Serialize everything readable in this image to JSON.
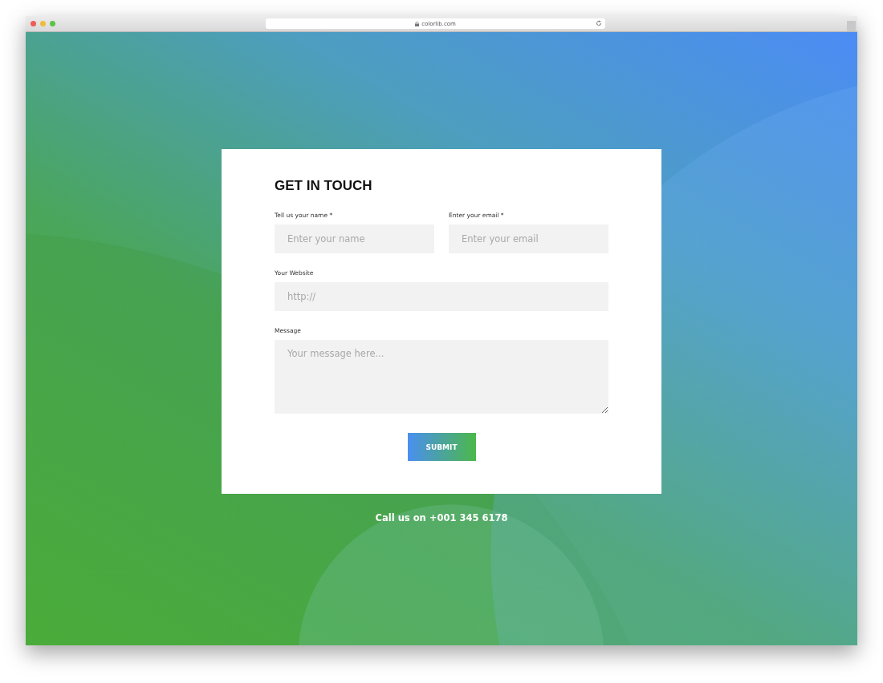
{
  "browser": {
    "url": "colorlib.com"
  },
  "form": {
    "title": "GET IN TOUCH",
    "rows": [
      [
        {
          "label": "Tell us your name *",
          "placeholder": "Enter your name",
          "kind": "input"
        },
        {
          "label": "Enter your email *",
          "placeholder": "Enter your email",
          "kind": "input"
        }
      ],
      [
        {
          "label": "Your Website",
          "placeholder": "http://",
          "kind": "input"
        }
      ],
      [
        {
          "label": "Message",
          "placeholder": "Your message here...",
          "kind": "textarea"
        }
      ]
    ],
    "submit": "SUBMIT"
  },
  "footer": {
    "text": "Call us on +001 345 6178"
  }
}
